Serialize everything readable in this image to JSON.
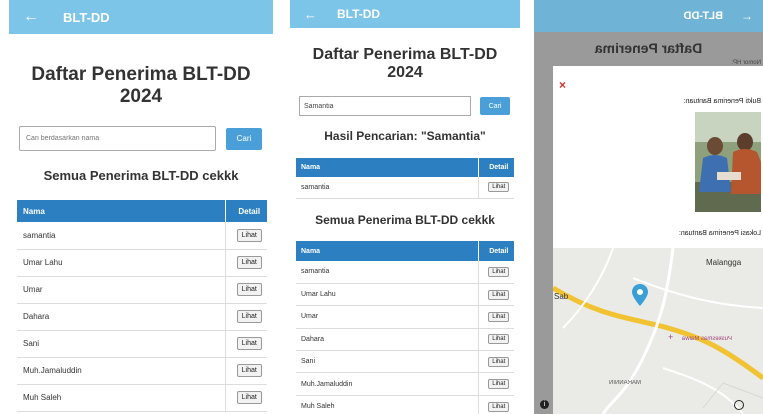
{
  "screens": [
    {
      "app_title": "BLT-DD",
      "page_title_line1": "Daftar Penerima BLT-DD",
      "page_title_line2": "2024",
      "search": {
        "placeholder": "Cari berdasarkan nama",
        "button": "Cari"
      },
      "section_title": "Semua Penerima BLT-DD cekkk",
      "table": {
        "col_name": "Nama",
        "col_detail": "Detail",
        "detail_label": "Lihat",
        "rows": [
          "samantia",
          "Umar Lahu",
          "Umar",
          "Dahara",
          "Sani",
          "Muh.Jamaluddin",
          "Muh Saleh"
        ]
      }
    },
    {
      "app_title": "BLT-DD",
      "page_title_line1": "Daftar Penerima BLT-DD",
      "page_title_line2": "2024",
      "search": {
        "value": "Samantia",
        "button": "Cari"
      },
      "result_title": "Hasil Pencarian: \"Samantia\"",
      "result_table": {
        "col_name": "Nama",
        "col_detail": "Detail",
        "detail_label": "Lihat",
        "rows": [
          "samantia"
        ]
      },
      "section_title": "Semua Penerima BLT-DD cekkk",
      "table": {
        "col_name": "Nama",
        "col_detail": "Detail",
        "detail_label": "Lihat",
        "rows": [
          "samantia",
          "Umar Lahu",
          "Umar",
          "Dahara",
          "Sani",
          "Muh.Jamaluddin",
          "Muh Saleh"
        ]
      }
    },
    {
      "app_title": "BLT-DD",
      "bg_title": "Daftar Penerima",
      "modal": {
        "close": "×",
        "small_label": "Nomor HP:",
        "photo_label": "Bukti Penerima Bantuan:",
        "location_label": "Lokasi Penerima Bantuan:",
        "map_labels": {
          "town1": "Malangga",
          "place": "Puskesmas Maiwa",
          "town2": "MARANNIN",
          "edge": "Sab"
        }
      }
    }
  ],
  "colors": {
    "appbar": "#7cc4e8",
    "table_header": "#2c7fc0",
    "button": "#4a9fd8",
    "close": "#d0302a",
    "map_pin": "#3a9fd6",
    "road": "#f1c232"
  }
}
